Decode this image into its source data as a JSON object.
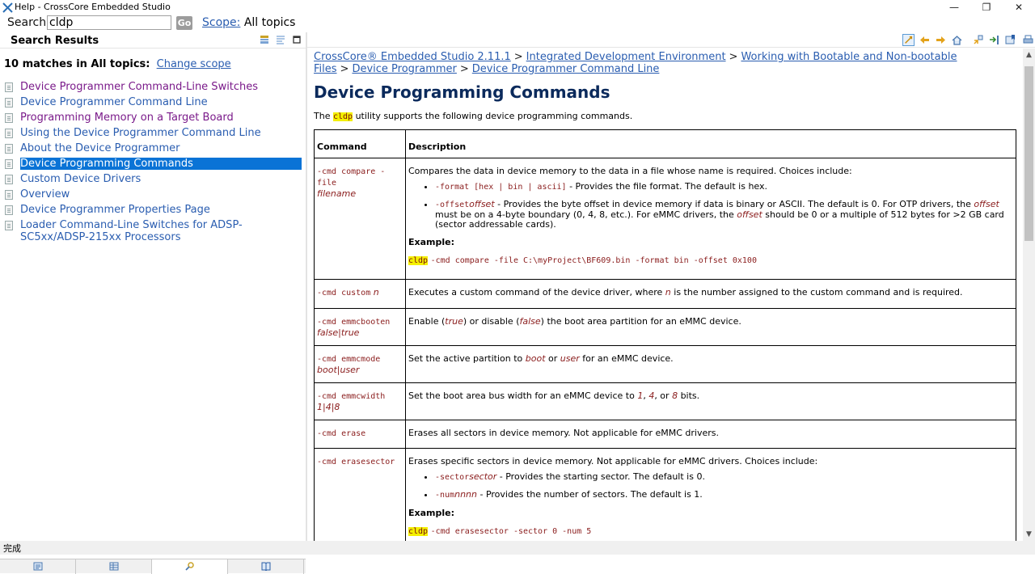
{
  "window": {
    "title": "Help - CrossCore Embedded Studio",
    "minimize": "—",
    "restore": "❐",
    "close": "✕"
  },
  "search": {
    "label": "Search:",
    "value": "cldp",
    "go_label": "Go",
    "scope_link": "Scope:",
    "scope_value": "All topics"
  },
  "left_pane": {
    "title": "Search Results",
    "matches_text": "10 matches in All topics:",
    "change_scope": "Change scope",
    "results": [
      {
        "label": "Device Programmer Command-Line Switches",
        "visited": true
      },
      {
        "label": "Device Programmer Command Line",
        "visited": false
      },
      {
        "label": "Programming Memory on a Target Board",
        "visited": true
      },
      {
        "label": "Using the Device Programmer Command Line",
        "visited": false
      },
      {
        "label": "About the Device Programmer",
        "visited": false
      },
      {
        "label": "Device Programming Commands",
        "visited": false,
        "selected": true
      },
      {
        "label": "Custom Device Drivers",
        "visited": false
      },
      {
        "label": "Overview",
        "visited": false
      },
      {
        "label": "Device Programmer Properties Page",
        "visited": false
      },
      {
        "label": "Loader Command-Line Switches for ADSP-SC5xx/ADSP-215xx Processors",
        "visited": false
      }
    ],
    "tabs": [
      "contents-icon",
      "index-icon",
      "search-icon",
      "bookmarks-icon"
    ]
  },
  "breadcrumb": {
    "items": [
      "CrossCore® Embedded Studio 2.11.1",
      "Integrated Development Environment",
      "Working with Bootable and Non-bootable Files",
      "Device Programmer",
      "Device Programmer Command Line"
    ],
    "separator": ">"
  },
  "page": {
    "title": "Device Programming Commands",
    "intro_before": "The",
    "intro_code": "cldp",
    "intro_after": "utility supports the following device programming commands.",
    "col_command": "Command",
    "col_description": "Description",
    "example_label": "Example:"
  },
  "rows": {
    "compare": {
      "cmd": "-cmd compare -file",
      "arg": "filename",
      "desc": "Compares the data in device memory to the data in a file whose name is required. Choices include:",
      "b1_code": "-format [hex | bin | ascii]",
      "b1_text": "- Provides the file format. The default is hex.",
      "b2_code": "-offset",
      "b2_var": "offset",
      "b2_text1": "- Provides the byte offset in device memory if data is binary or ASCII. The default is 0. For OTP drivers, the",
      "b2_var2": "offset",
      "b2_text2": "must be on a 4-byte boundary (0, 4, 8, etc.). For eMMC drivers, the",
      "b2_var3": "offset",
      "b2_text3": "should be 0 or a multiple of 512 bytes for >2 GB card (sector addressable cards).",
      "ex_hl": "cldp",
      "ex_rest": "-cmd compare -file C:\\myProject\\BF609.bin -format bin -offset 0x100"
    },
    "custom": {
      "cmd": "-cmd custom",
      "arg": "n",
      "desc1": "Executes a custom command of the device driver, where",
      "desc_var": "n",
      "desc2": "is the number assigned to the custom command and is required."
    },
    "emmcbooten": {
      "cmd": "-cmd emmcbooten",
      "arg": "false|true",
      "d1": "Enable (",
      "v1": "true",
      "d2": ") or disable (",
      "v2": "false",
      "d3": ") the boot area partition for an eMMC device."
    },
    "emmcmode": {
      "cmd": "-cmd emmcmode",
      "arg": "boot|user",
      "d1": "Set the active partition to",
      "v1": "boot",
      "d2": "or",
      "v2": "user",
      "d3": "for an eMMC device."
    },
    "emmcwidth": {
      "cmd": "-cmd emmcwidth",
      "arg": "1|4|8",
      "d1": "Set the boot area bus width for an eMMC device to",
      "v1": "1",
      "d2": ",",
      "v2": "4",
      "d3": ", or",
      "v3": "8",
      "d4": "bits."
    },
    "erase": {
      "cmd": "-cmd erase",
      "desc": "Erases all sectors in device memory. Not applicable for eMMC drivers."
    },
    "erasesector": {
      "cmd": "-cmd erasesector",
      "desc": "Erases specific sectors in device memory. Not applicable for eMMC drivers. Choices include:",
      "b1_code": "-sector",
      "b1_var": "sector",
      "b1_text": "- Provides the starting sector. The default is 0.",
      "b2_code": "-num",
      "b2_var": "nnnn",
      "b2_text": "- Provides the number of sectors. The default is 1.",
      "ex_hl": "cldp",
      "ex_rest": "-cmd erasesector -sector 0 -num 5"
    }
  },
  "status": {
    "text": "完成"
  },
  "colors": {
    "link": "#2a5db0",
    "visited": "#7a1a8a",
    "selection": "#0a73d6",
    "title": "#0b2a5c",
    "code": "#8a1c1c",
    "highlight": "#f4f000"
  }
}
